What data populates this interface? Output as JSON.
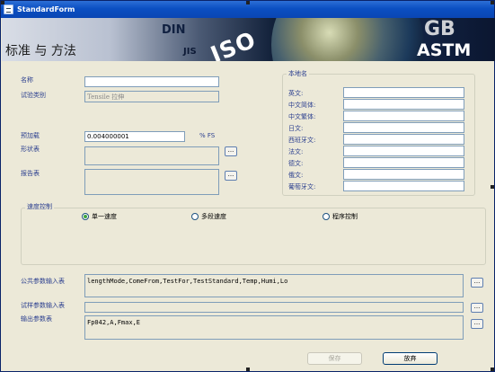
{
  "window": {
    "title": "StandardForm"
  },
  "banner": {
    "title": "标准 与 方法",
    "logos": [
      "DIN",
      "JIS",
      "ISO",
      "GB",
      "ASTM"
    ]
  },
  "form": {
    "name_label": "名称",
    "name_value": "",
    "test_type_label": "试验类别",
    "test_type_value": "Tensile 拉伸",
    "preload_label": "预加载",
    "preload_value": "0.004000001",
    "preload_unit": "% FS",
    "shape_label": "形状表",
    "report_label": "报告表",
    "browse_label": "..."
  },
  "local_names": {
    "group_label": "本地名",
    "fields": [
      {
        "label": "英文:",
        "value": ""
      },
      {
        "label": "中文简体:",
        "value": ""
      },
      {
        "label": "中文繁体:",
        "value": ""
      },
      {
        "label": "日文:",
        "value": ""
      },
      {
        "label": "西班牙文:",
        "value": ""
      },
      {
        "label": "法文:",
        "value": ""
      },
      {
        "label": "德文:",
        "value": ""
      },
      {
        "label": "俄文:",
        "value": ""
      },
      {
        "label": "葡萄牙文:",
        "value": ""
      }
    ]
  },
  "speed_control": {
    "group_label": "速度控制",
    "options": [
      {
        "label": "单一速度",
        "selected": true
      },
      {
        "label": "多段速度",
        "selected": false
      },
      {
        "label": "程序控制",
        "selected": false
      }
    ]
  },
  "params": {
    "public_label": "公共参数输入表",
    "public_value": "lengthMode,ComeFrom,TestFor,TestStandard,Temp,Humi,Lo",
    "sample_label": "试样参数输入表",
    "sample_value": "",
    "output_label": "输出参数表",
    "output_value": "Fp042,A,Fmax,E"
  },
  "buttons": {
    "save": "保存",
    "discard": "放弃"
  }
}
